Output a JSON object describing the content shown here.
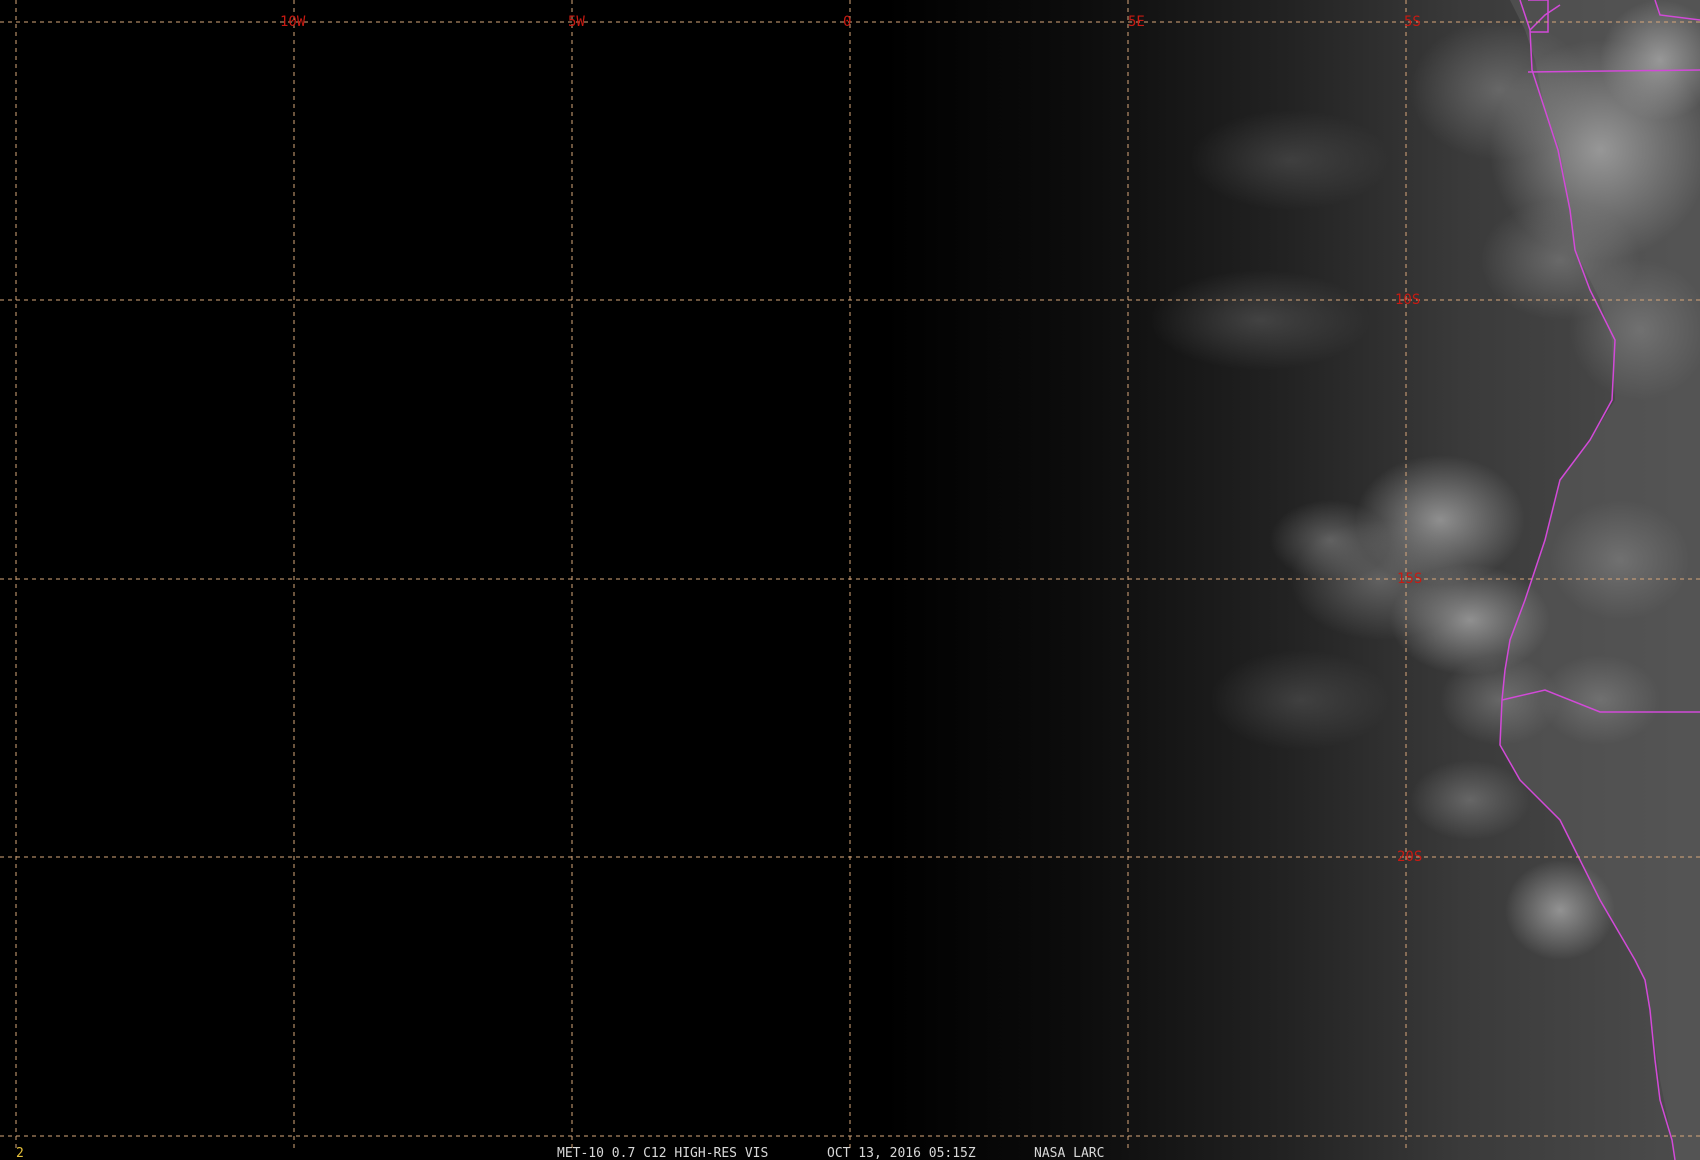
{
  "map": {
    "longitude_labels": [
      "10W",
      "5W",
      "0",
      "5E",
      "5S"
    ],
    "latitude_labels": [
      "10S",
      "15S",
      "20S"
    ],
    "colors": {
      "grid": "#d9a77a",
      "grid_label": "#c81a12",
      "border": "#d24ad8",
      "frame_number": "#e8c23a"
    }
  },
  "status_bar": {
    "frame_number": "2",
    "product": "MET-10 0.7 C12 HIGH-RES VIS",
    "datetime": "OCT 13, 2016 05:15Z",
    "source": "NASA LARC"
  }
}
